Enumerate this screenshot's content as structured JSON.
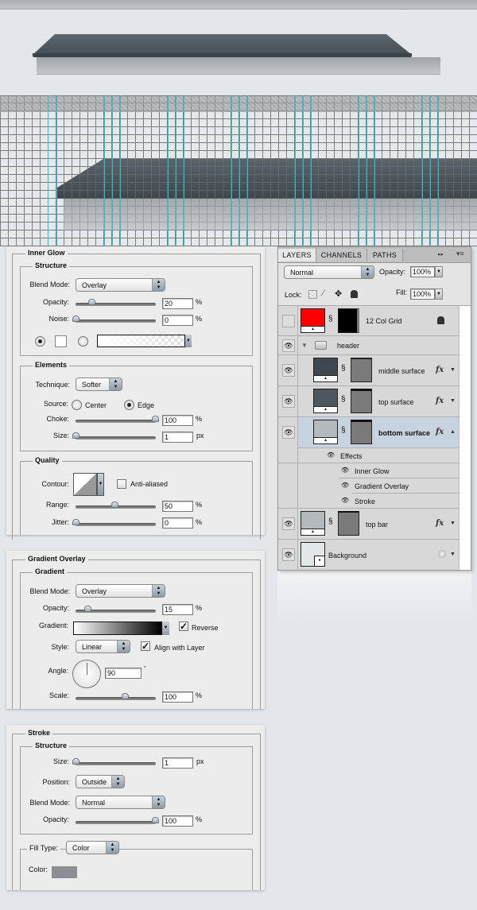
{
  "preview": {
    "colors": {
      "guide": "#19c8d2",
      "top_surface": "#4e575e",
      "bottom_surface": "#b4b8bb"
    }
  },
  "inner_glow": {
    "title": "Inner Glow",
    "structure": {
      "title": "Structure",
      "blend_mode_label": "Blend Mode:",
      "blend_mode": "Overlay",
      "opacity_label": "Opacity:",
      "opacity": "20",
      "opacity_unit": "%",
      "noise_label": "Noise:",
      "noise": "0",
      "noise_unit": "%",
      "fill_mode": "color",
      "color": "#ffffff"
    },
    "elements": {
      "title": "Elements",
      "technique_label": "Technique:",
      "technique": "Softer",
      "source_label": "Source:",
      "source_center": "Center",
      "source_edge": "Edge",
      "source_selected": "Edge",
      "choke_label": "Choke:",
      "choke": "100",
      "choke_unit": "%",
      "size_label": "Size:",
      "size": "1",
      "size_unit": "px"
    },
    "quality": {
      "title": "Quality",
      "contour_label": "Contour:",
      "anti_aliased_label": "Anti-aliased",
      "anti_aliased": false,
      "range_label": "Range:",
      "range": "50",
      "range_unit": "%",
      "jitter_label": "Jitter:",
      "jitter": "0",
      "jitter_unit": "%"
    }
  },
  "gradient_overlay": {
    "title": "Gradient Overlay",
    "gradient_group": "Gradient",
    "blend_mode_label": "Blend Mode:",
    "blend_mode": "Overlay",
    "opacity_label": "Opacity:",
    "opacity": "15",
    "opacity_unit": "%",
    "gradient_label": "Gradient:",
    "reverse_label": "Reverse",
    "reverse": true,
    "style_label": "Style:",
    "style": "Linear",
    "align_label": "Align with Layer",
    "align": true,
    "angle_label": "Angle:",
    "angle": "90",
    "angle_unit": "°",
    "scale_label": "Scale:",
    "scale": "100",
    "scale_unit": "%"
  },
  "stroke": {
    "title": "Stroke",
    "structure_title": "Structure",
    "size_label": "Size:",
    "size": "1",
    "size_unit": "px",
    "position_label": "Position:",
    "position": "Outside",
    "blend_mode_label": "Blend Mode:",
    "blend_mode": "Normal",
    "opacity_label": "Opacity:",
    "opacity": "100",
    "opacity_unit": "%",
    "fill_type_label": "Fill Type:",
    "fill_type": "Color",
    "color_label": "Color:",
    "color": "#8a8f93"
  },
  "layers_panel": {
    "tabs": [
      "LAYERS",
      "CHANNELS",
      "PATHS"
    ],
    "active_tab": "LAYERS",
    "blend_mode": "Normal",
    "opacity_label": "Opacity:",
    "opacity": "100%",
    "lock_label": "Lock:",
    "fill_label": "Fill:",
    "fill": "100%",
    "layers": [
      {
        "name": "12 Col Grid",
        "visible": false,
        "color": "#ff0000",
        "locked": true
      },
      {
        "name": "header",
        "type": "group",
        "visible": true,
        "expanded": true
      },
      {
        "name": "middle surface",
        "visible": true,
        "color": "#3f474e",
        "fx": "fx"
      },
      {
        "name": "top surface",
        "visible": true,
        "color": "#4e575e",
        "fx": "fx"
      },
      {
        "name": "bottom surface",
        "visible": true,
        "color": "#b4b9bc",
        "fx": "fx",
        "selected": true,
        "effects_label": "Effects",
        "effects": [
          "Inner Glow",
          "Gradient Overlay",
          "Stroke"
        ]
      },
      {
        "name": "top bar",
        "visible": true,
        "color": "#b4b9bc",
        "fx": "fx"
      },
      {
        "name": "Background",
        "visible": true,
        "color": "#e3e7ea"
      }
    ]
  }
}
